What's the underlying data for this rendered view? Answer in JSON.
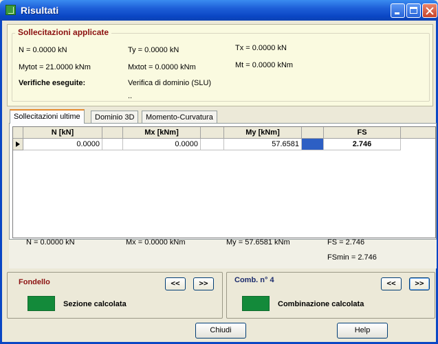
{
  "window": {
    "title": "Risultati"
  },
  "applied": {
    "legend": "Sollecitazioni applicate",
    "n": "N = 0.0000 kN",
    "ty": "Ty = 0.0000 kN",
    "tx": "Tx = 0.0000 kN",
    "mytot": "Mytot = 21.0000 kNm",
    "mxtot": "Mxtot = 0.0000 kNm",
    "mt": "Mt = 0.0000 kNm",
    "checks_label": "Verifiche eseguite:",
    "checks_value": "Verifica di dominio (SLU)",
    "checks_extra": ".."
  },
  "tabs": [
    {
      "label": "Sollecitazioni ultime",
      "active": true
    },
    {
      "label": "Dominio 3D",
      "active": false
    },
    {
      "label": "Momento-Curvatura",
      "active": false
    }
  ],
  "grid": {
    "headers": [
      "N [kN]",
      "Mx [kNm]",
      "My [kNm]",
      "FS"
    ],
    "rows": [
      {
        "n": "0.0000",
        "mx": "0.0000",
        "my": "57.6581",
        "fs": "2.746",
        "fs_color": "#2d5fc4"
      }
    ]
  },
  "summary": {
    "n": "N = 0.0000 kN",
    "mx": "Mx = 0.0000 kNm",
    "my": "My = 57.6581 kNm",
    "fs": "FS = 2.746",
    "fsmin": "FSmin = 2.746"
  },
  "left_panel": {
    "title": "Fondello",
    "prev": "<<",
    "next": ">>",
    "status": "Sezione calcolata",
    "status_color": "#138a3a"
  },
  "right_panel": {
    "title": "Comb. n° 4",
    "prev": "<<",
    "next": ">>",
    "status": "Combinazione calcolata",
    "status_color": "#138a3a"
  },
  "buttons": {
    "close": "Chiudi",
    "help": "Help"
  }
}
